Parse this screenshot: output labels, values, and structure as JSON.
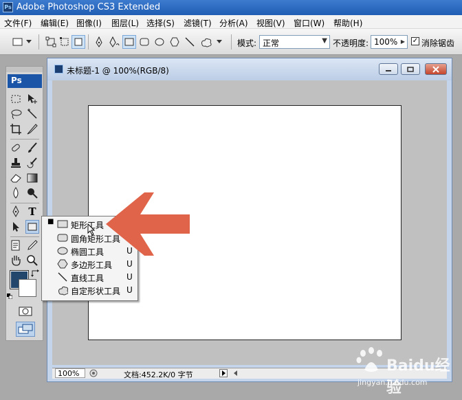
{
  "app": {
    "title": "Adobe Photoshop CS3 Extended",
    "logo_text": "Ps"
  },
  "menu": [
    "文件(F)",
    "编辑(E)",
    "图像(I)",
    "图层(L)",
    "选择(S)",
    "滤镜(T)",
    "分析(A)",
    "视图(V)",
    "窗口(W)",
    "帮助(H)"
  ],
  "options": {
    "mode_label": "模式:",
    "mode_value": "正常",
    "opacity_label": "不透明度:",
    "opacity_value": "100%",
    "antialias_label": "消除锯齿",
    "antialias_checked": "✓"
  },
  "toolbox": {
    "header": "Ps",
    "fg_color": "#23466c",
    "bg_color": "#ffffff"
  },
  "document": {
    "title": "未标题-1 @ 100%(RGB/8)",
    "zoom": "100%",
    "status": "文档:452.2K/0 字节"
  },
  "flyout": {
    "items": [
      {
        "label": "矩形工具",
        "key": "U",
        "icon": "rectangle-icon",
        "active": true
      },
      {
        "label": "圆角矩形工具",
        "key": "U",
        "icon": "rounded-rectangle-icon",
        "active": false
      },
      {
        "label": "椭圆工具",
        "key": "U",
        "icon": "ellipse-icon",
        "active": false
      },
      {
        "label": "多边形工具",
        "key": "U",
        "icon": "polygon-icon",
        "active": false
      },
      {
        "label": "直线工具",
        "key": "U",
        "icon": "line-icon",
        "active": false
      },
      {
        "label": "自定形状工具",
        "key": "U",
        "icon": "custom-shape-icon",
        "active": false
      }
    ]
  },
  "annotation": {
    "arrow_color": "#e0644a"
  },
  "watermark": {
    "brand": "Baidu经验",
    "url": "jingyan.baidu.com"
  }
}
